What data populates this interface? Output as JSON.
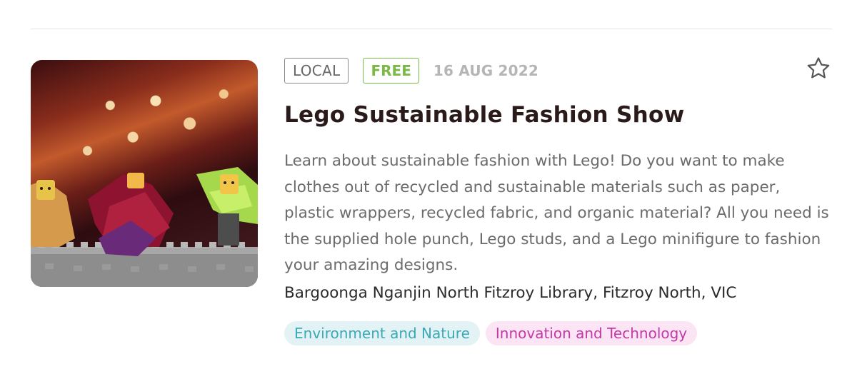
{
  "event": {
    "tag_local": "LOCAL",
    "tag_free": "FREE",
    "date": "16 AUG 2022",
    "title": "Lego Sustainable Fashion Show",
    "description": "Learn about sustainable fashion with Lego! Do you want to make clothes out of recycled and sustainable materials such as paper, plastic wrappers, recycled fabric, and organic material? All you need is the supplied hole punch, Lego studs, and a Lego minifigure to fashion your amazing designs.",
    "location": "Bargoonga Nganjin North Fitzroy Library, Fitzroy North, VIC",
    "categories": [
      {
        "label": "Environment and Nature",
        "color": "#3aa9b6",
        "bg": "#e3f3f5"
      },
      {
        "label": "Innovation and Technology",
        "color": "#c23aa6",
        "bg": "#fbe4f3"
      }
    ],
    "favorite_icon": "star-outline-icon"
  },
  "colors": {
    "free": "#7ab848",
    "title": "#2a1a1a",
    "date": "#b5b5b5"
  }
}
